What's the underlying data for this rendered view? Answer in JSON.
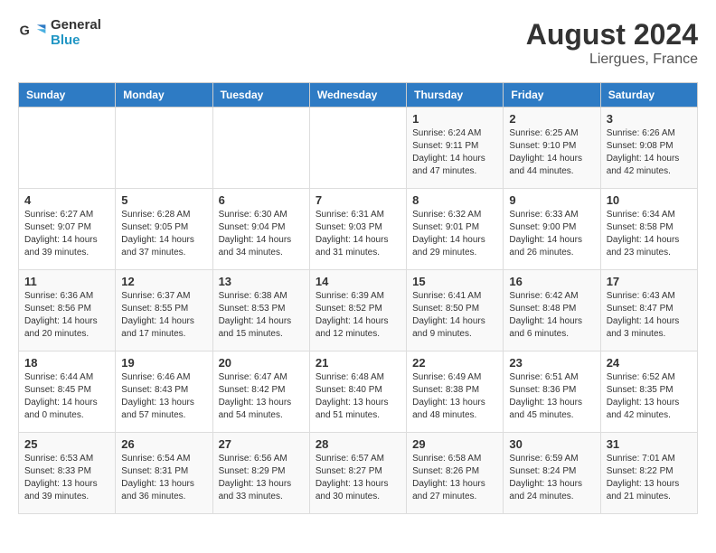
{
  "logo": {
    "line1": "General",
    "line2": "Blue"
  },
  "title": "August 2024",
  "subtitle": "Liergues, France",
  "days_of_week": [
    "Sunday",
    "Monday",
    "Tuesday",
    "Wednesday",
    "Thursday",
    "Friday",
    "Saturday"
  ],
  "weeks": [
    [
      {
        "day": "",
        "info": ""
      },
      {
        "day": "",
        "info": ""
      },
      {
        "day": "",
        "info": ""
      },
      {
        "day": "",
        "info": ""
      },
      {
        "day": "1",
        "info": "Sunrise: 6:24 AM\nSunset: 9:11 PM\nDaylight: 14 hours and 47 minutes."
      },
      {
        "day": "2",
        "info": "Sunrise: 6:25 AM\nSunset: 9:10 PM\nDaylight: 14 hours and 44 minutes."
      },
      {
        "day": "3",
        "info": "Sunrise: 6:26 AM\nSunset: 9:08 PM\nDaylight: 14 hours and 42 minutes."
      }
    ],
    [
      {
        "day": "4",
        "info": "Sunrise: 6:27 AM\nSunset: 9:07 PM\nDaylight: 14 hours and 39 minutes."
      },
      {
        "day": "5",
        "info": "Sunrise: 6:28 AM\nSunset: 9:05 PM\nDaylight: 14 hours and 37 minutes."
      },
      {
        "day": "6",
        "info": "Sunrise: 6:30 AM\nSunset: 9:04 PM\nDaylight: 14 hours and 34 minutes."
      },
      {
        "day": "7",
        "info": "Sunrise: 6:31 AM\nSunset: 9:03 PM\nDaylight: 14 hours and 31 minutes."
      },
      {
        "day": "8",
        "info": "Sunrise: 6:32 AM\nSunset: 9:01 PM\nDaylight: 14 hours and 29 minutes."
      },
      {
        "day": "9",
        "info": "Sunrise: 6:33 AM\nSunset: 9:00 PM\nDaylight: 14 hours and 26 minutes."
      },
      {
        "day": "10",
        "info": "Sunrise: 6:34 AM\nSunset: 8:58 PM\nDaylight: 14 hours and 23 minutes."
      }
    ],
    [
      {
        "day": "11",
        "info": "Sunrise: 6:36 AM\nSunset: 8:56 PM\nDaylight: 14 hours and 20 minutes."
      },
      {
        "day": "12",
        "info": "Sunrise: 6:37 AM\nSunset: 8:55 PM\nDaylight: 14 hours and 17 minutes."
      },
      {
        "day": "13",
        "info": "Sunrise: 6:38 AM\nSunset: 8:53 PM\nDaylight: 14 hours and 15 minutes."
      },
      {
        "day": "14",
        "info": "Sunrise: 6:39 AM\nSunset: 8:52 PM\nDaylight: 14 hours and 12 minutes."
      },
      {
        "day": "15",
        "info": "Sunrise: 6:41 AM\nSunset: 8:50 PM\nDaylight: 14 hours and 9 minutes."
      },
      {
        "day": "16",
        "info": "Sunrise: 6:42 AM\nSunset: 8:48 PM\nDaylight: 14 hours and 6 minutes."
      },
      {
        "day": "17",
        "info": "Sunrise: 6:43 AM\nSunset: 8:47 PM\nDaylight: 14 hours and 3 minutes."
      }
    ],
    [
      {
        "day": "18",
        "info": "Sunrise: 6:44 AM\nSunset: 8:45 PM\nDaylight: 14 hours and 0 minutes."
      },
      {
        "day": "19",
        "info": "Sunrise: 6:46 AM\nSunset: 8:43 PM\nDaylight: 13 hours and 57 minutes."
      },
      {
        "day": "20",
        "info": "Sunrise: 6:47 AM\nSunset: 8:42 PM\nDaylight: 13 hours and 54 minutes."
      },
      {
        "day": "21",
        "info": "Sunrise: 6:48 AM\nSunset: 8:40 PM\nDaylight: 13 hours and 51 minutes."
      },
      {
        "day": "22",
        "info": "Sunrise: 6:49 AM\nSunset: 8:38 PM\nDaylight: 13 hours and 48 minutes."
      },
      {
        "day": "23",
        "info": "Sunrise: 6:51 AM\nSunset: 8:36 PM\nDaylight: 13 hours and 45 minutes."
      },
      {
        "day": "24",
        "info": "Sunrise: 6:52 AM\nSunset: 8:35 PM\nDaylight: 13 hours and 42 minutes."
      }
    ],
    [
      {
        "day": "25",
        "info": "Sunrise: 6:53 AM\nSunset: 8:33 PM\nDaylight: 13 hours and 39 minutes."
      },
      {
        "day": "26",
        "info": "Sunrise: 6:54 AM\nSunset: 8:31 PM\nDaylight: 13 hours and 36 minutes."
      },
      {
        "day": "27",
        "info": "Sunrise: 6:56 AM\nSunset: 8:29 PM\nDaylight: 13 hours and 33 minutes."
      },
      {
        "day": "28",
        "info": "Sunrise: 6:57 AM\nSunset: 8:27 PM\nDaylight: 13 hours and 30 minutes."
      },
      {
        "day": "29",
        "info": "Sunrise: 6:58 AM\nSunset: 8:26 PM\nDaylight: 13 hours and 27 minutes."
      },
      {
        "day": "30",
        "info": "Sunrise: 6:59 AM\nSunset: 8:24 PM\nDaylight: 13 hours and 24 minutes."
      },
      {
        "day": "31",
        "info": "Sunrise: 7:01 AM\nSunset: 8:22 PM\nDaylight: 13 hours and 21 minutes."
      }
    ]
  ]
}
